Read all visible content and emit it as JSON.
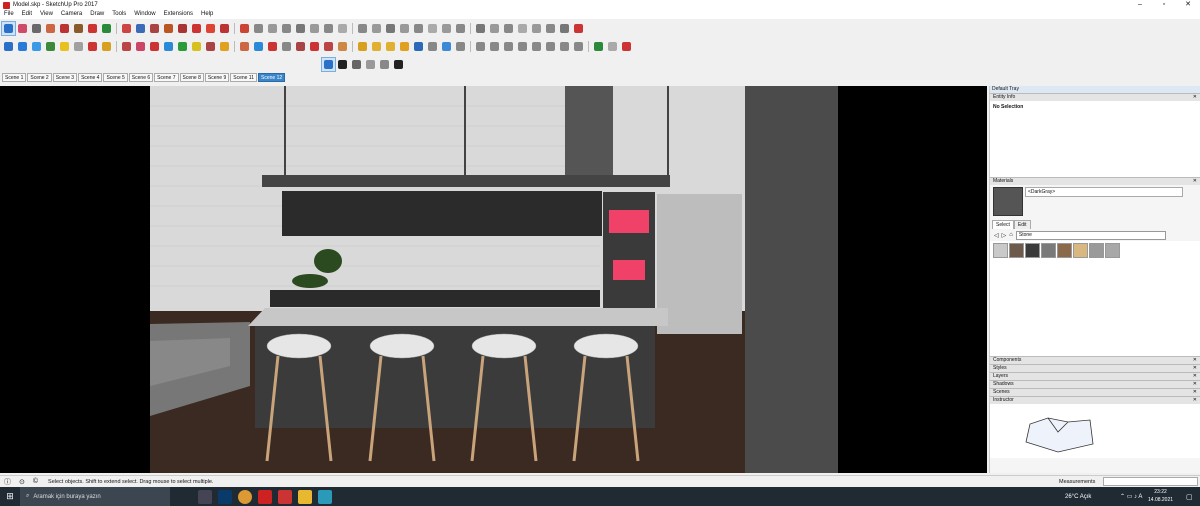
{
  "window": {
    "title": "Model.skp - SketchUp Pro 2017"
  },
  "menu": [
    "File",
    "Edit",
    "View",
    "Camera",
    "Draw",
    "Tools",
    "Window",
    "Extensions",
    "Help"
  ],
  "toolbar_colors": {
    "row1": [
      "#2a6fc8",
      "#d04a6a",
      "#6a6a6a",
      "#c64",
      "#b33",
      "#8a5a2a",
      "#c33",
      "#2a8a3a",
      "#c44",
      "#3a6ab8",
      "#a44",
      "#b52",
      "#a33",
      "#c33",
      "#d43",
      "#b33",
      "#c43",
      "#888",
      "#999",
      "#888",
      "#777",
      "#999",
      "#888",
      "#aaa",
      "#888",
      "#999",
      "#777",
      "#999",
      "#888",
      "#aaa",
      "#999",
      "#888",
      "#777",
      "#999",
      "#888",
      "#aaa",
      "#999",
      "#888",
      "#777",
      "#c33"
    ],
    "row2": [
      "#2a6fc8",
      "#2a7ad8",
      "#3a9ae8",
      "#3a8a3a",
      "#e8c020",
      "#a0a0a0",
      "#c33",
      "#d8a020",
      "#b44",
      "#c46",
      "#c33",
      "#2a8ad8",
      "#2a9a3a",
      "#d8c020",
      "#a44",
      "#e0a020",
      "#c64",
      "#2a8ad8",
      "#c33",
      "#888",
      "#a44",
      "#c33",
      "#b44",
      "#c84",
      "#d8a020",
      "#e0b030",
      "#e0b030",
      "#e0a020",
      "#2a6ab8",
      "#888",
      "#3a8ad8",
      "#888",
      "#888",
      "#888",
      "#888",
      "#888",
      "#888",
      "#888",
      "#888",
      "#888",
      "#2a8a3a",
      "#aaa",
      "#c33"
    ],
    "row3": [
      "#2a6fc8",
      "#222",
      "#666",
      "#999",
      "#888",
      "#222"
    ]
  },
  "scenes": [
    "Scene 1",
    "Scene 2",
    "Scene 3",
    "Scene 4",
    "Scene 5",
    "Scene 6",
    "Scene 7",
    "Scene 8",
    "Scene 9",
    "Scene 11",
    "Scene 12"
  ],
  "active_scene": "Scene 12",
  "tray": {
    "title": "Default Tray",
    "entity_info": {
      "header": "Entity Info",
      "value": "No Selection"
    },
    "materials": {
      "header": "Materials",
      "current": "<DarkGray>",
      "tabs": [
        "Select",
        "Edit"
      ],
      "library": "Stone",
      "swatches": [
        "#c9c9c9",
        "#6e5a4a",
        "#3a3a3a",
        "#7a7a7a",
        "#8a6a4a",
        "#d8b880",
        "#9a9a9a",
        "#a8a8a8"
      ]
    },
    "collapsed": [
      "Components",
      "Styles",
      "Layers",
      "Shadows",
      "Scenes"
    ],
    "instructor": "Instructor"
  },
  "status": {
    "message": "Select objects. Shift to extend select. Drag mouse to select multiple.",
    "measurements_label": "Measurements"
  },
  "taskbar": {
    "search_placeholder": "Aramak için buraya yazın",
    "weather": "26°C  Açık",
    "time": "23:22",
    "date": "14.08.2021"
  }
}
